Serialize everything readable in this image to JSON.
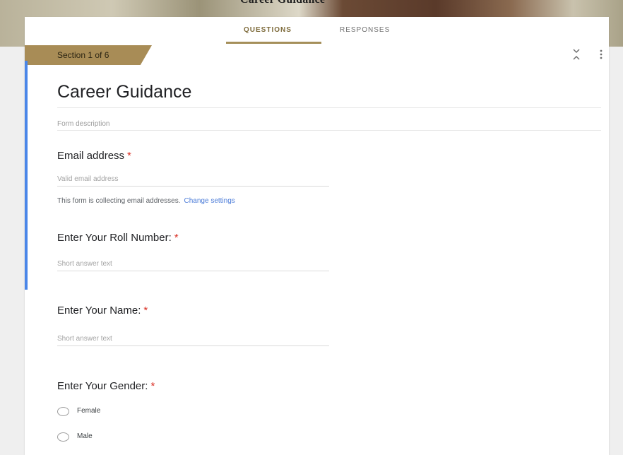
{
  "window": {
    "title": "Career Guidance"
  },
  "tabs": [
    {
      "label": "QUESTIONS",
      "active": true
    },
    {
      "label": "RESPONSES",
      "active": false
    }
  ],
  "section": {
    "label": "Section 1 of 6"
  },
  "icons": {
    "collapse": "collapse-icon",
    "more": "more-vert-icon"
  },
  "form": {
    "title": "Career Guidance",
    "description_placeholder": "Form description"
  },
  "email": {
    "question": "Email address",
    "required_mark": "*",
    "placeholder": "Valid email address",
    "note": "This form is collecting email addresses.",
    "change_link": "Change settings"
  },
  "questions": [
    {
      "label": "Enter Your Roll Number:",
      "required_mark": "*",
      "placeholder": "Short answer text"
    },
    {
      "label": "Enter Your Name:",
      "required_mark": "*",
      "placeholder": "Short answer text"
    },
    {
      "label": "Enter Your Gender:",
      "required_mark": "*",
      "options": [
        "Female",
        "Male"
      ]
    }
  ],
  "colors": {
    "accent": "#a88c56",
    "active_tab": "#7d6a3a",
    "left_bar": "#4a86e8",
    "required": "#d93025",
    "link": "#4a7bd8"
  }
}
